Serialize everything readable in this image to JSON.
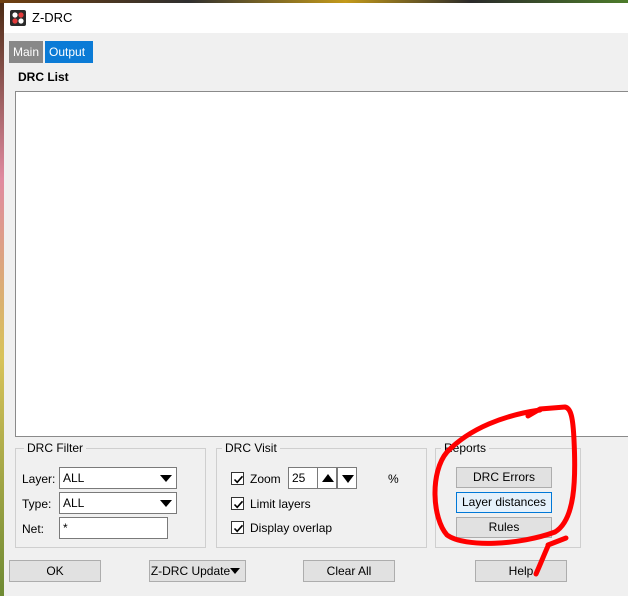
{
  "window": {
    "title": "Z-DRC",
    "icon": "app-logo-icon"
  },
  "tabs": [
    {
      "label": "Main",
      "active": false
    },
    {
      "label": "Output",
      "active": true
    }
  ],
  "drc_list": {
    "label": "DRC List",
    "items": []
  },
  "drc_filter": {
    "title": "DRC Filter",
    "layer_label": "Layer:",
    "layer_value": "ALL",
    "type_label": "Type:",
    "type_value": "ALL",
    "net_label": "Net:",
    "net_value": "*"
  },
  "drc_visit": {
    "title": "DRC Visit",
    "zoom_label": "Zoom",
    "zoom_checked": true,
    "zoom_value": "25",
    "zoom_unit": "%",
    "limit_layers_label": "Limit layers",
    "limit_layers_checked": true,
    "display_overlap_label": "Display overlap",
    "display_overlap_checked": true
  },
  "reports": {
    "title": "Reports",
    "drc_errors_label": "DRC Errors",
    "layer_distances_label": "Layer distances",
    "rules_label": "Rules"
  },
  "footer": {
    "ok_label": "OK",
    "update_label": "Z-DRC Update",
    "clear_all_label": "Clear All",
    "help_label": "Help"
  },
  "annotation": {
    "color": "#ff0000"
  }
}
